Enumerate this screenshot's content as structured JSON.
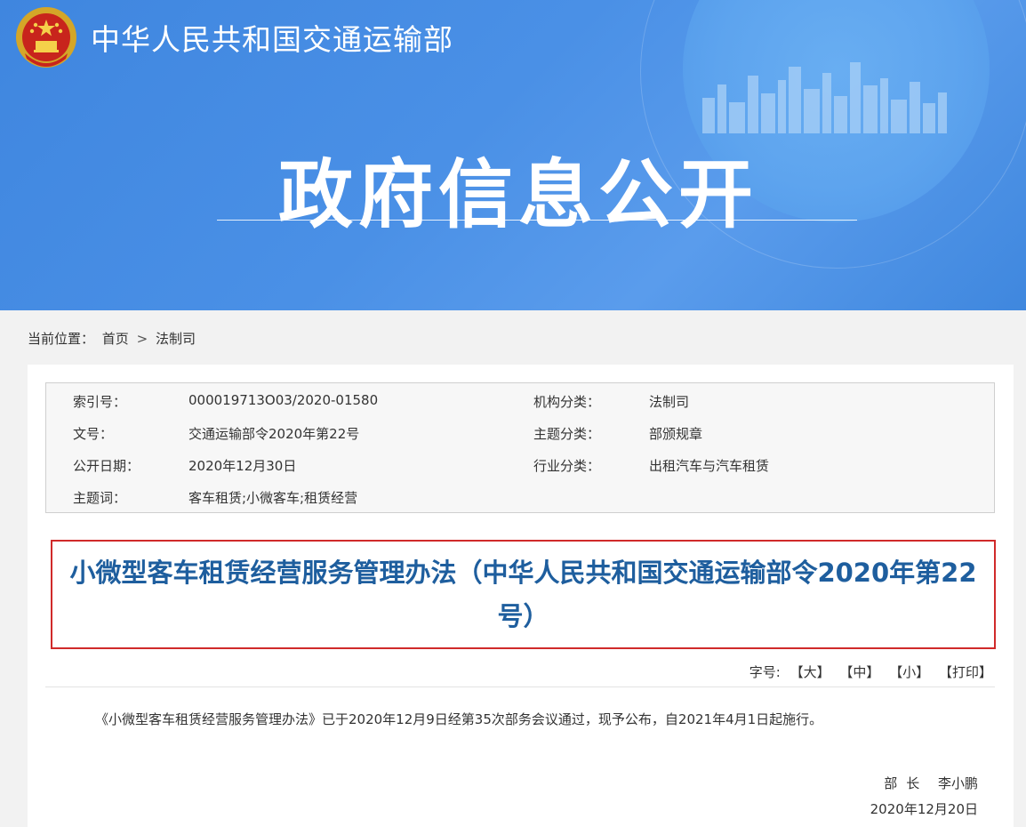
{
  "header": {
    "ministry_name": "中华人民共和国交通运输部",
    "section_title": "政府信息公开"
  },
  "breadcrumb": {
    "prefix": "当前位置：",
    "items": [
      "首页",
      "法制司"
    ],
    "separator": ">"
  },
  "meta": {
    "index_label": "索引号：",
    "index_value": "000019713O03/2020-01580",
    "org_label": "机构分类：",
    "org_value": "法制司",
    "docno_label": "文号：",
    "docno_value": "交通运输部令2020年第22号",
    "topic_label": "主题分类：",
    "topic_value": "部颁规章",
    "date_label": "公开日期：",
    "date_value": "2020年12月30日",
    "industry_label": "行业分类：",
    "industry_value": "出租汽车与汽车租赁",
    "keywords_label": "主题词：",
    "keywords_value": "客车租赁;小微客车;租赁经营"
  },
  "document": {
    "title": "小微型客车租赁经营服务管理办法（中华人民共和国交通运输部令2020年第22号）",
    "body": "《小微型客车租赁经营服务管理办法》已于2020年12月9日经第35次部务会议通过，现予公布，自2021年4月1日起施行。",
    "signer_role": "部长",
    "signer_name": "李小鹏",
    "sign_date": "2020年12月20日"
  },
  "font_tools": {
    "label": "字号:",
    "large": "【大】",
    "medium": "【中】",
    "small": "【小】",
    "print": "【打印】"
  },
  "colors": {
    "banner_blue": "#4a90e6",
    "title_blue": "#1e5e9e",
    "highlight_red": "#d02a2a"
  }
}
